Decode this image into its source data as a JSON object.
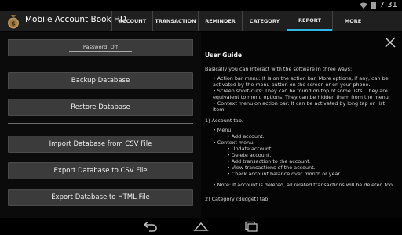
{
  "status_bar": {
    "time": "7:31"
  },
  "app": {
    "title": "Mobile Account Book HD"
  },
  "tabs": [
    {
      "label": "ACCOUNT"
    },
    {
      "label": "TRANSACTION"
    },
    {
      "label": "REMINDER"
    },
    {
      "label": "CATEGORY"
    },
    {
      "label": "REPORT"
    },
    {
      "label": "MORE"
    }
  ],
  "left": {
    "password": "Password: Off",
    "buttons": [
      {
        "label": "Backup Database"
      },
      {
        "label": "Restore Database"
      },
      {
        "label": "Import Database from CSV File"
      },
      {
        "label": "Export Database to CSV File"
      },
      {
        "label": "Export Database to HTML File"
      }
    ]
  },
  "guide": {
    "title": "User Guide",
    "intro": "Basically you can interact with the software in three ways:",
    "ways": [
      "• Action bar menu: It is on the action bar. More options, if any, can be activated by the menu button on the screen or on your phone.",
      "• Screen short-cuts: They can be found on top of some lists. They are equivalent to menu options. They can be hidden them from the menu.",
      "• Context menu on action bar: It can be activated by long tap on list item."
    ],
    "section1": "1) Account tab.",
    "menu_label": "• Menu:",
    "menu_items": [
      "• Add account."
    ],
    "context_label": "• Context menu:",
    "context_items": [
      "• Update account.",
      "• Delete account.",
      "• Add transaction to the account.",
      "• View transactions of the account.",
      "• Check account balance over month or year."
    ],
    "note": "• Note: If account is deleted, all related transactions will be deleted too.",
    "section2": "2) Category (Budget) tab:"
  }
}
